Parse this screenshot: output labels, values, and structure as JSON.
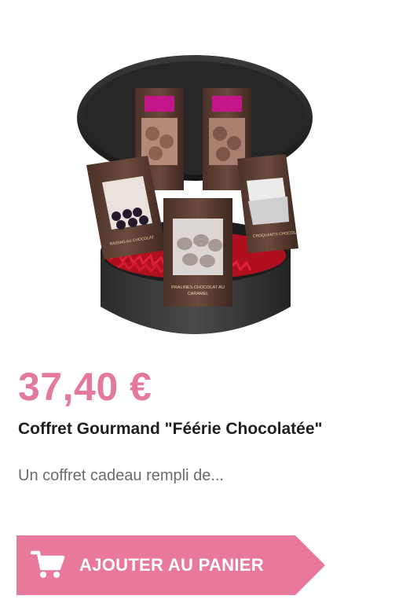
{
  "product": {
    "image_alt": "Coffret Gourmand Féérie Chocolatée",
    "price": "37,40 €",
    "title": "Coffret Gourmand \"Féérie Chocolatée\"",
    "description": "Un coffret cadeau rempli de...",
    "package_labels": {
      "left": "RAISINS AU CHOCOLAT",
      "front": "PRALINES CHOCOLAT AU CARAMEL",
      "right": "CROQUANTS CHOCOLAT"
    }
  },
  "cart_button": {
    "label": "AJOUTER AU PANIER",
    "icon": "shopping-cart-icon"
  },
  "colors": {
    "price": "#e47a9b",
    "button": "#e8799b",
    "title": "#1f1f1f",
    "description": "#6b6b6b"
  }
}
